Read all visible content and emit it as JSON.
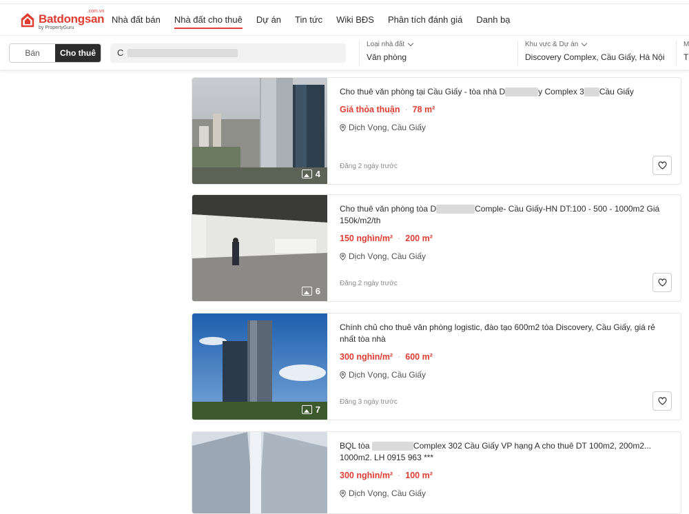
{
  "brand": {
    "domain": ".com.vn",
    "name": "Batdongsan",
    "tagline": "by PropertyGuru",
    "color": "#e03c31"
  },
  "nav": [
    {
      "label": "Nhà đất bán",
      "active": false
    },
    {
      "label": "Nhà đất cho thuê",
      "active": true
    },
    {
      "label": "Dự án",
      "active": false
    },
    {
      "label": "Tin tức",
      "active": false
    },
    {
      "label": "Wiki BĐS",
      "active": false
    },
    {
      "label": "Phân tích đánh giá",
      "active": false
    },
    {
      "label": "Danh bạ",
      "active": false
    }
  ],
  "search": {
    "toggle": {
      "sell": "Bán",
      "rent": "Cho thuê",
      "selected": "rent"
    },
    "query_prefix": "C",
    "filters": [
      {
        "label": "Loại nhà đất",
        "value": "Văn phòng"
      },
      {
        "label": "Khu vực & Dự án",
        "value": "Discovery Complex, Cầu Giấy, Hà Nội"
      },
      {
        "label": "M",
        "value": "Tấ"
      }
    ]
  },
  "listings": [
    {
      "title_parts": [
        "Cho thuê văn phòng tại Cầu Giấy - tòa nhà D",
        "y Complex 3",
        "Cầu Giấy"
      ],
      "price": "Giá thỏa thuận",
      "area": "78 m²",
      "location": "Dịch Vọng, Cầu Giấy",
      "posted": "Đăng 2 ngày trước",
      "photos": "4",
      "icon": "image-icon"
    },
    {
      "title_parts": [
        "Cho thuê văn phòng tòa D",
        "Comple- Cầu Giấy-HN DT:100 - 500 - 1000m2 Giá 150k/m2/th"
      ],
      "price": "150 nghìn/m²",
      "area": "200 m²",
      "location": "Dịch Vọng, Cầu Giấy",
      "posted": "Đăng 2 ngày trước",
      "photos": "6"
    },
    {
      "title_parts": [
        "Chính chủ cho thuê văn phòng logistic, đào tạo 600m2 tòa ",
        "Discovery, Cầu Giấy, giá rẻ nhất tòa nhà"
      ],
      "price": "300 nghìn/m²",
      "area": "600 m²",
      "location": "Dịch Vọng, Cầu Giấy",
      "posted": "Đăng 3 ngày trước",
      "photos": "7"
    },
    {
      "title_parts": [
        "BQL tòa ",
        "Complex 302 Cầu Giấy VP hạng A cho thuê DT 100m2, 200m2... 1000m2. LH 0915 963 ***"
      ],
      "price": "300 nghìn/m²",
      "area": "100 m²",
      "location": "Dịch Vọng, Cầu Giấy",
      "posted": "",
      "photos": ""
    }
  ]
}
